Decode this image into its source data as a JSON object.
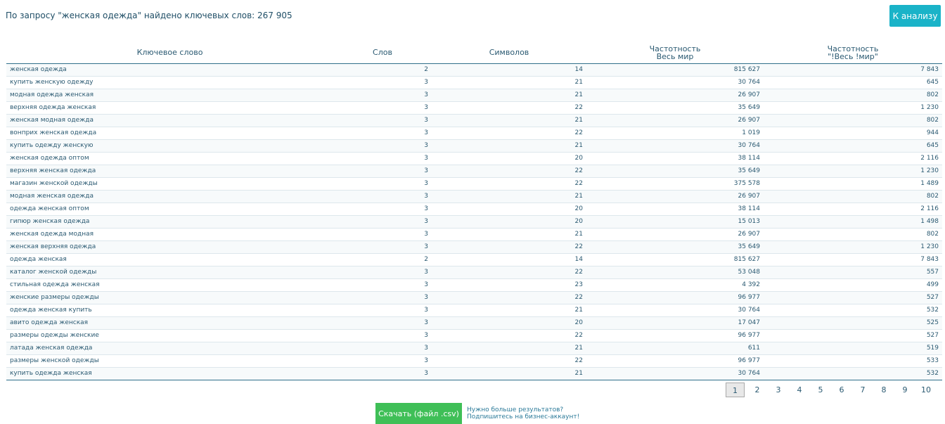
{
  "header": {
    "summary": "По запросу \"женская одежда\" найдено ключевых слов: 267 905",
    "analyze_label": "К анализу"
  },
  "table": {
    "columns": {
      "keyword": "Ключевое слово",
      "words": "Слов",
      "chars": "Символов",
      "freq_world_line1": "Частотность",
      "freq_world_line2": "Весь мир",
      "freq_exact_line1": "Частотность",
      "freq_exact_line2": "\"!Весь !мир\""
    },
    "rows": [
      {
        "keyword": "женская одежда",
        "words": "2",
        "chars": "14",
        "freq": "815 627",
        "exact": "7 843"
      },
      {
        "keyword": "купить женскую одежду",
        "words": "3",
        "chars": "21",
        "freq": "30 764",
        "exact": "645"
      },
      {
        "keyword": "модная одежда женская",
        "words": "3",
        "chars": "21",
        "freq": "26 907",
        "exact": "802"
      },
      {
        "keyword": "верхняя одежда женская",
        "words": "3",
        "chars": "22",
        "freq": "35 649",
        "exact": "1 230"
      },
      {
        "keyword": "женская модная одежда",
        "words": "3",
        "chars": "21",
        "freq": "26 907",
        "exact": "802"
      },
      {
        "keyword": "вонприх женская одежда",
        "words": "3",
        "chars": "22",
        "freq": "1 019",
        "exact": "944"
      },
      {
        "keyword": "купить одежду женскую",
        "words": "3",
        "chars": "21",
        "freq": "30 764",
        "exact": "645"
      },
      {
        "keyword": "женская одежда оптом",
        "words": "3",
        "chars": "20",
        "freq": "38 114",
        "exact": "2 116"
      },
      {
        "keyword": "верхняя женская одежда",
        "words": "3",
        "chars": "22",
        "freq": "35 649",
        "exact": "1 230"
      },
      {
        "keyword": "магазин женской одежды",
        "words": "3",
        "chars": "22",
        "freq": "375 578",
        "exact": "1 489"
      },
      {
        "keyword": "модная женская одежда",
        "words": "3",
        "chars": "21",
        "freq": "26 907",
        "exact": "802"
      },
      {
        "keyword": "одежда женская оптом",
        "words": "3",
        "chars": "20",
        "freq": "38 114",
        "exact": "2 116"
      },
      {
        "keyword": "гипюр женская одежда",
        "words": "3",
        "chars": "20",
        "freq": "15 013",
        "exact": "1 498"
      },
      {
        "keyword": "женская одежда модная",
        "words": "3",
        "chars": "21",
        "freq": "26 907",
        "exact": "802"
      },
      {
        "keyword": "женская верхняя одежда",
        "words": "3",
        "chars": "22",
        "freq": "35 649",
        "exact": "1 230"
      },
      {
        "keyword": "одежда женская",
        "words": "2",
        "chars": "14",
        "freq": "815 627",
        "exact": "7 843"
      },
      {
        "keyword": "каталог женской одежды",
        "words": "3",
        "chars": "22",
        "freq": "53 048",
        "exact": "557"
      },
      {
        "keyword": "стильная одежда женская",
        "words": "3",
        "chars": "23",
        "freq": "4 392",
        "exact": "499"
      },
      {
        "keyword": "женские размеры одежды",
        "words": "3",
        "chars": "22",
        "freq": "96 977",
        "exact": "527"
      },
      {
        "keyword": "одежда женская купить",
        "words": "3",
        "chars": "21",
        "freq": "30 764",
        "exact": "532"
      },
      {
        "keyword": "авито одежда женская",
        "words": "3",
        "chars": "20",
        "freq": "17 047",
        "exact": "525"
      },
      {
        "keyword": "размеры одежды женские",
        "words": "3",
        "chars": "22",
        "freq": "96 977",
        "exact": "527"
      },
      {
        "keyword": "латада женская одежда",
        "words": "3",
        "chars": "21",
        "freq": "611",
        "exact": "519"
      },
      {
        "keyword": "размеры женской одежды",
        "words": "3",
        "chars": "22",
        "freq": "96 977",
        "exact": "533"
      },
      {
        "keyword": "купить одежда женская",
        "words": "3",
        "chars": "21",
        "freq": "30 764",
        "exact": "532"
      }
    ]
  },
  "pagination": {
    "current": "1",
    "pages": [
      "2",
      "3",
      "4",
      "5",
      "6",
      "7",
      "8",
      "9",
      "10"
    ]
  },
  "footer": {
    "download_label": "Скачать (файл .csv)",
    "promo_line1": "Нужно больше результатов?",
    "promo_line2": "Подпишитесь на бизнес-аккаунт!"
  },
  "colors": {
    "accent": "#1ab3c8",
    "download": "#3fbf57",
    "text": "#1f4e66"
  }
}
